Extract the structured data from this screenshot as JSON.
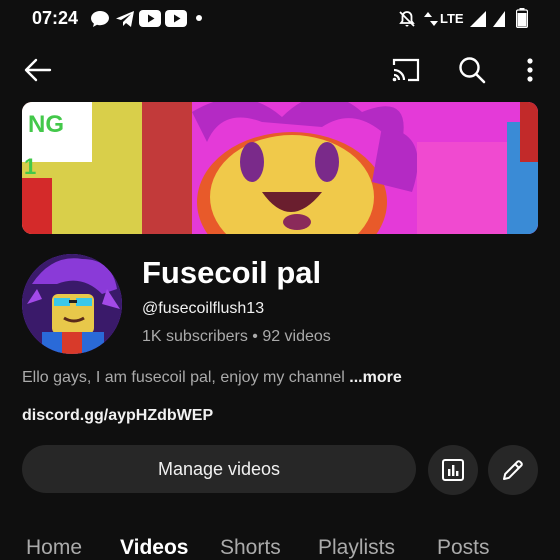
{
  "status_bar": {
    "time": "07:24",
    "network": "LTE"
  },
  "top_bar": {
    "back_icon": "arrow-left-icon",
    "cast_icon": "cast-icon",
    "search_icon": "search-icon",
    "more_icon": "more-vert-icon"
  },
  "banner": {
    "text_fragments": [
      "NG",
      "1"
    ]
  },
  "channel": {
    "name": "Fusecoil pal",
    "handle": "@fusecoilflush13",
    "stats": "1K subscribers • 92 videos",
    "description": "Ello gays, I am fusecoil pal, enjoy my channel ",
    "more_label": "...more",
    "link": "discord.gg/aypHZdbWEP"
  },
  "actions": {
    "manage_label": "Manage videos",
    "analytics_icon": "analytics-icon",
    "edit_icon": "pencil-icon"
  },
  "tabs": [
    {
      "label": "Home",
      "active": false
    },
    {
      "label": "Videos",
      "active": true
    },
    {
      "label": "Shorts",
      "active": false
    },
    {
      "label": "Playlists",
      "active": false
    },
    {
      "label": "Posts",
      "active": false
    }
  ],
  "colors": {
    "background": "#0f0f0f",
    "button_bg": "#272727",
    "secondary_text": "#aaaaaa",
    "banner_magenta": "#e43ad8"
  }
}
